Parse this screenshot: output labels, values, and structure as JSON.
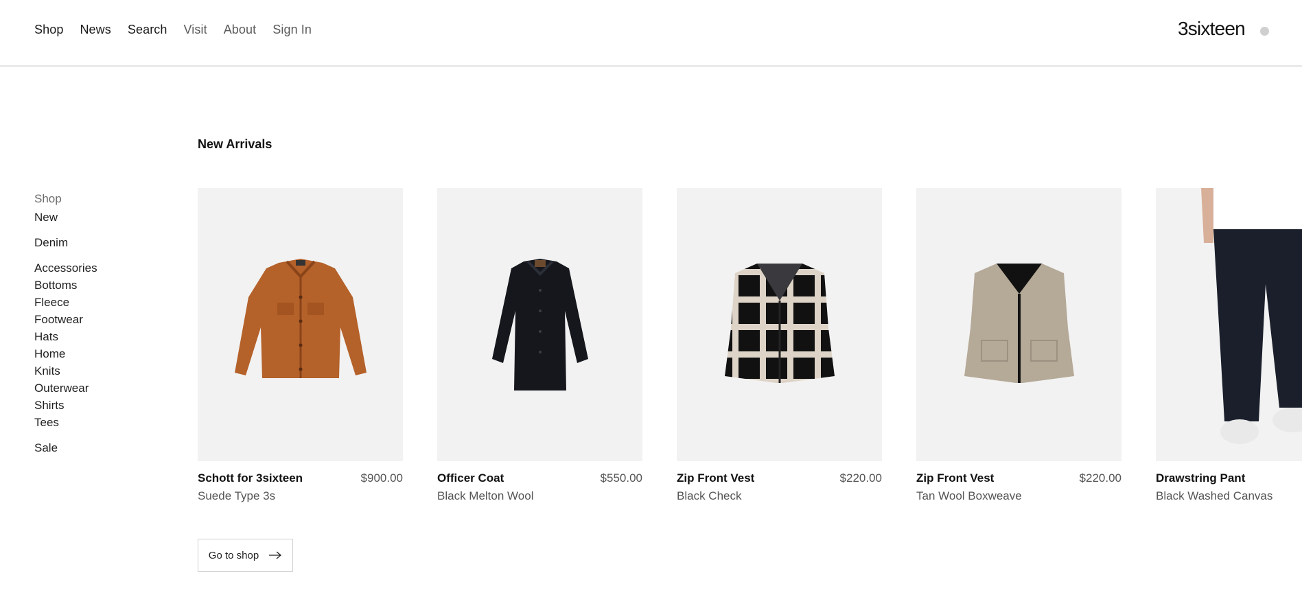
{
  "nav": {
    "items": [
      {
        "label": "Shop"
      },
      {
        "label": "News"
      },
      {
        "label": "Search"
      },
      {
        "label": "Visit"
      },
      {
        "label": "About"
      },
      {
        "label": "Sign In"
      }
    ]
  },
  "brand": {
    "logo_text": "3sixteen"
  },
  "section": {
    "title": "New Arrivals"
  },
  "sidebar": {
    "heading": "Shop",
    "items": [
      {
        "label": "New"
      },
      {
        "label": "Denim"
      },
      {
        "label": "Accessories"
      },
      {
        "label": "Bottoms"
      },
      {
        "label": "Fleece"
      },
      {
        "label": "Footwear"
      },
      {
        "label": "Hats"
      },
      {
        "label": "Home"
      },
      {
        "label": "Knits"
      },
      {
        "label": "Outerwear"
      },
      {
        "label": "Shirts"
      },
      {
        "label": "Tees"
      },
      {
        "label": "Sale"
      }
    ]
  },
  "products": [
    {
      "name": "Schott for 3sixteen",
      "price": "$900.00",
      "subtitle": "Suede Type 3s",
      "icon": "suede-jacket-icon"
    },
    {
      "name": "Officer Coat",
      "price": "$550.00",
      "subtitle": "Black Melton Wool",
      "icon": "coat-icon"
    },
    {
      "name": "Zip Front Vest",
      "price": "$220.00",
      "subtitle": "Black Check",
      "icon": "check-vest-icon"
    },
    {
      "name": "Zip Front Vest",
      "price": "$220.00",
      "subtitle": "Tan Wool Boxweave",
      "icon": "tan-vest-icon"
    },
    {
      "name": "Drawstring Pant",
      "price": "",
      "subtitle": "Black Washed Canvas",
      "icon": "pant-icon"
    }
  ],
  "cta": {
    "label": "Go to shop",
    "icon": "arrow-right-icon"
  },
  "colors": {
    "card_bg": "#f2f2f2",
    "text": "#111111",
    "muted": "#555555",
    "suede": "#b4612a",
    "tan": "#b5a998"
  }
}
